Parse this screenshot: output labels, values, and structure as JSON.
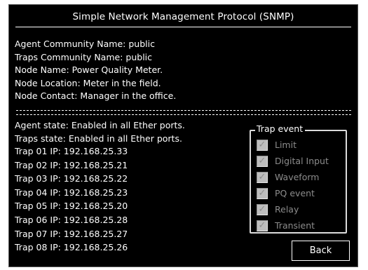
{
  "window": {
    "title": "Simple Network Management Protocol (SNMP)"
  },
  "info_lines": [
    "Agent Community Name: public",
    "Traps Community Name: public",
    "Node Name: Power Quality Meter.",
    "Node Location: Meter in the field.",
    "Node Contact: Manager in the office."
  ],
  "separator": "===================================================",
  "status_lines": [
    "Agent state: Enabled in all Ether ports.",
    "Traps state: Enabled in all Ether ports."
  ],
  "trap_ips": [
    "Trap 01 IP: 192.168.25.33",
    "Trap 02 IP: 192.168.25.21",
    "Trap 03 IP: 192.168.25.22",
    "Trap 04 IP: 192.168.25.23",
    "Trap 05 IP: 192.168.25.20",
    "Trap 06 IP: 192.168.25.28",
    "Trap 07 IP: 192.168.25.27",
    "Trap 08 IP: 192.168.25.26"
  ],
  "trap_event": {
    "title": "Trap event",
    "items": [
      {
        "label": "Limit",
        "checked": true,
        "enabled": false
      },
      {
        "label": "Digital Input",
        "checked": true,
        "enabled": false
      },
      {
        "label": "Waveform",
        "checked": true,
        "enabled": false
      },
      {
        "label": "PQ event",
        "checked": true,
        "enabled": false
      },
      {
        "label": "Relay",
        "checked": true,
        "enabled": false
      },
      {
        "label": "Transient",
        "checked": true,
        "enabled": false
      }
    ],
    "check_glyph": "✓"
  },
  "buttons": {
    "back": "Back"
  },
  "colors": {
    "background": "#000000",
    "text": "#ffffff",
    "disabled_text": "#8c8c8c",
    "checkbox_fill": "#bdbdbd"
  }
}
